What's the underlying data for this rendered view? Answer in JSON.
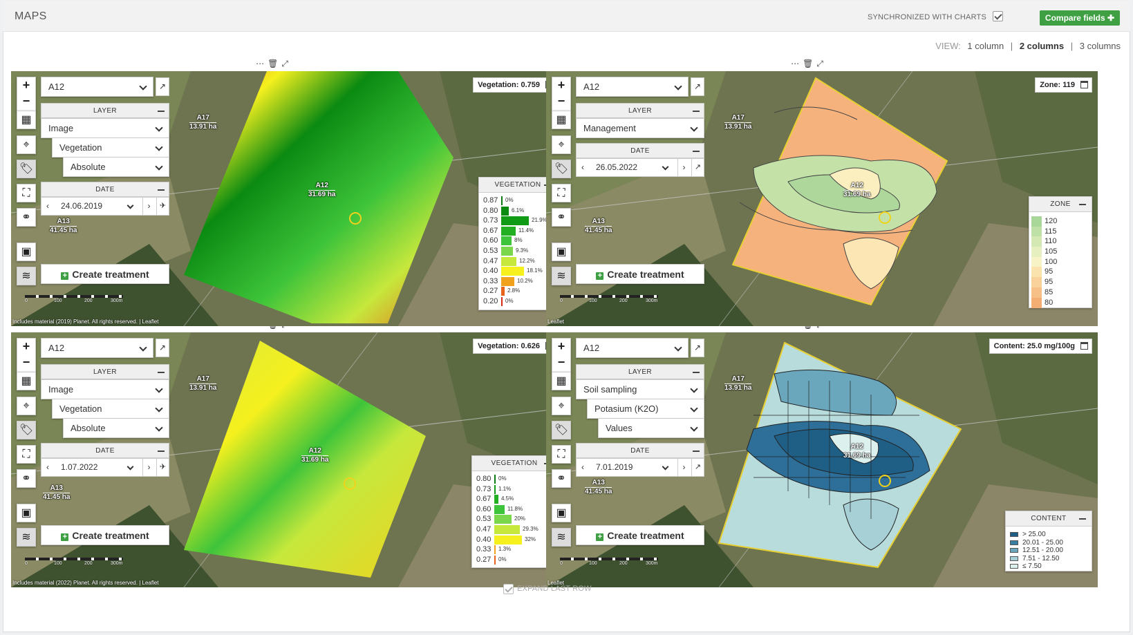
{
  "header": {
    "title": "MAPS",
    "sync_label": "SYNCHRONIZED WITH CHARTS",
    "compare_label": "Compare fields ✚"
  },
  "view": {
    "label": "VIEW:",
    "options": [
      "1 column",
      "2 columns",
      "3 columns"
    ],
    "active": "2 columns"
  },
  "common": {
    "field": "A12",
    "layer_header": "LAYER",
    "date_header": "DATE",
    "create_label": "Create treatment",
    "leaflet": "Leaflet",
    "scale_ticks": [
      "0",
      "100",
      "200",
      "300m"
    ]
  },
  "field_labels": {
    "a17": {
      "name": "A17",
      "area": "13.91 ha"
    },
    "a12": {
      "name": "A12",
      "area": "31.69 ha"
    },
    "a13": {
      "name": "A13",
      "area": "41.45 ha"
    }
  },
  "panels": [
    {
      "layer": "Image",
      "sub1": "Vegetation",
      "sub2": "Absolute",
      "date": "24.06.2019",
      "readout": "Vegetation: 0.759",
      "legend_title": "VEGETATION",
      "attribution": "Includes material (2019) Planet. All rights reserved. | Leaflet",
      "legend": [
        {
          "v": "0.87",
          "p": "0%",
          "f": 0.0,
          "c": "#0a7a10"
        },
        {
          "v": "0.80",
          "p": "6.1%",
          "f": 0.28,
          "c": "#0b8a12"
        },
        {
          "v": "0.73",
          "p": "21.9%",
          "f": 1.0,
          "c": "#109a16"
        },
        {
          "v": "0.67",
          "p": "11.4%",
          "f": 0.52,
          "c": "#22b022"
        },
        {
          "v": "0.60",
          "p": "8%",
          "f": 0.37,
          "c": "#3ec43a"
        },
        {
          "v": "0.53",
          "p": "9.3%",
          "f": 0.42,
          "c": "#7ad64a"
        },
        {
          "v": "0.47",
          "p": "12.2%",
          "f": 0.56,
          "c": "#c6e83c"
        },
        {
          "v": "0.40",
          "p": "18.1%",
          "f": 0.83,
          "c": "#f5f01e"
        },
        {
          "v": "0.33",
          "p": "10.2%",
          "f": 0.47,
          "c": "#f0a21c"
        },
        {
          "v": "0.27",
          "p": "2.8%",
          "f": 0.13,
          "c": "#e8641a"
        },
        {
          "v": "0.20",
          "p": "0%",
          "f": 0.0,
          "c": "#d82a18"
        }
      ]
    },
    {
      "layer": "Management",
      "date": "26.05.2022",
      "readout": "Zone: 119",
      "legend_title": "ZONE",
      "zones": [
        {
          "v": "120",
          "c": "#a9d79a"
        },
        {
          "v": "115",
          "c": "#bfe0a6"
        },
        {
          "v": "110",
          "c": "#d3e8b3"
        },
        {
          "v": "105",
          "c": "#e6efbf"
        },
        {
          "v": "100",
          "c": "#f7f3c6"
        },
        {
          "v": "95",
          "c": "#fbe3ad"
        },
        {
          "v": "95",
          "c": "#f9d19a"
        },
        {
          "v": "85",
          "c": "#f7c088"
        },
        {
          "v": "80",
          "c": "#f4ae74"
        }
      ]
    },
    {
      "layer": "Image",
      "sub1": "Vegetation",
      "sub2": "Absolute",
      "date": "1.07.2022",
      "readout": "Vegetation: 0.626",
      "legend_title": "VEGETATION",
      "attribution": "Includes material (2022) Planet. All rights reserved. | Leaflet",
      "legend": [
        {
          "v": "0.80",
          "p": "0%",
          "f": 0.0,
          "c": "#0a7a10"
        },
        {
          "v": "0.73",
          "p": "1.1%",
          "f": 0.03,
          "c": "#109a16"
        },
        {
          "v": "0.67",
          "p": "4.5%",
          "f": 0.14,
          "c": "#22b022"
        },
        {
          "v": "0.60",
          "p": "11.8%",
          "f": 0.37,
          "c": "#3ec43a"
        },
        {
          "v": "0.53",
          "p": "20%",
          "f": 0.62,
          "c": "#7ad64a"
        },
        {
          "v": "0.47",
          "p": "29.3%",
          "f": 0.92,
          "c": "#c6e83c"
        },
        {
          "v": "0.40",
          "p": "32%",
          "f": 1.0,
          "c": "#f5f01e"
        },
        {
          "v": "0.33",
          "p": "1.3%",
          "f": 0.04,
          "c": "#f0a21c"
        },
        {
          "v": "0.27",
          "p": "0%",
          "f": 0.0,
          "c": "#e8641a"
        }
      ]
    },
    {
      "layer": "Soil sampling",
      "sub1": "Potasium (K2O)",
      "sub2": "Values",
      "date": "7.01.2019",
      "readout": "Content: 25.0 mg/100g",
      "legend_title": "CONTENT",
      "content": [
        {
          "v": "> 25.00",
          "c": "#1f5f86"
        },
        {
          "v": "20.01 - 25.00",
          "c": "#3a7fa2"
        },
        {
          "v": "12.51 - 20.00",
          "c": "#6aa7bc"
        },
        {
          "v": "7.51 - 12.50",
          "c": "#a6d0d6"
        },
        {
          "v": "≤ 7.50",
          "c": "#dcf0ee"
        }
      ]
    }
  ],
  "footer": {
    "expand_label": "EXPAND LAST ROW"
  }
}
